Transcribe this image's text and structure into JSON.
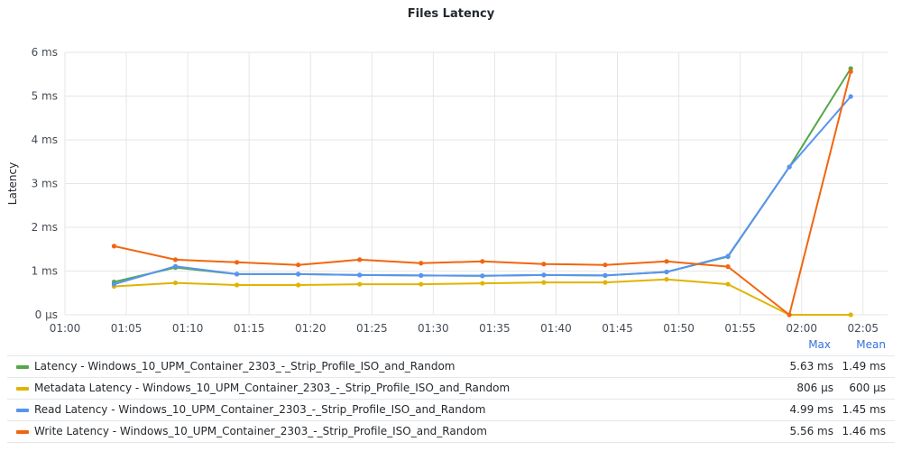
{
  "chart_data": {
    "type": "line",
    "title": "Files Latency",
    "ylabel": "Latency",
    "xlabel": "",
    "x_ticks": [
      "01:00",
      "01:05",
      "01:10",
      "01:15",
      "01:20",
      "01:25",
      "01:30",
      "01:35",
      "01:40",
      "01:45",
      "01:50",
      "01:55",
      "02:00",
      "02:05"
    ],
    "y_ticks": [
      "0 µs",
      "1 ms",
      "2 ms",
      "3 ms",
      "4 ms",
      "5 ms",
      "6 ms"
    ],
    "ylim": [
      0,
      6
    ],
    "y_unit": "ms",
    "xlim": [
      "01:00",
      "02:07"
    ],
    "grid": true,
    "legend_placement": "bottom table",
    "legend_columns": [
      "Max",
      "Mean"
    ],
    "x": [
      "01:04",
      "01:09",
      "01:14",
      "01:19",
      "01:24",
      "01:29",
      "01:34",
      "01:39",
      "01:44",
      "01:49",
      "01:54",
      "01:59",
      "02:04"
    ],
    "series": [
      {
        "name": "Latency - Windows_10_UPM_Container_2303_-_Strip_Profile_ISO_and_Random",
        "color": "#56a64b",
        "values": [
          0.75,
          1.08,
          0.93,
          0.93,
          0.91,
          0.9,
          0.89,
          0.91,
          0.9,
          0.98,
          1.33,
          3.38,
          5.63
        ],
        "max": "5.63 ms",
        "mean": "1.49 ms"
      },
      {
        "name": "Metadata Latency - Windows_10_UPM_Container_2303_-_Strip_Profile_ISO_and_Random",
        "color": "#e0b400",
        "values": [
          0.65,
          0.73,
          0.68,
          0.68,
          0.7,
          0.7,
          0.72,
          0.74,
          0.74,
          0.81,
          0.7,
          0.0,
          0.0
        ],
        "max": "806 µs",
        "mean": "600 µs"
      },
      {
        "name": "Read Latency - Windows_10_UPM_Container_2303_-_Strip_Profile_ISO_and_Random",
        "color": "#5794f2",
        "values": [
          0.7,
          1.11,
          0.93,
          0.93,
          0.91,
          0.9,
          0.89,
          0.91,
          0.9,
          0.98,
          1.34,
          3.38,
          4.99
        ],
        "max": "4.99 ms",
        "mean": "1.45 ms"
      },
      {
        "name": "Write Latency - Windows_10_UPM_Container_2303_-_Strip_Profile_ISO_and_Random",
        "color": "#f2650f",
        "values": [
          1.57,
          1.26,
          1.2,
          1.14,
          1.26,
          1.18,
          1.22,
          1.16,
          1.14,
          1.22,
          1.1,
          0.0,
          5.56
        ],
        "max": "5.56 ms",
        "mean": "1.46 ms"
      }
    ]
  }
}
